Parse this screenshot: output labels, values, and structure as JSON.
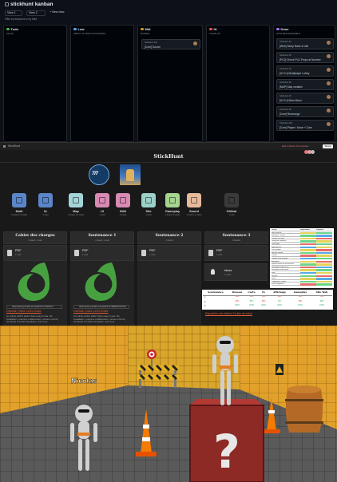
{
  "kanban": {
    "title": "stickhunt kanban",
    "tabs": [
      "View 1",
      "View 2",
      "+ New view"
    ],
    "filter_placeholder": "Filter by keyword or by field",
    "columns": [
      {
        "name": "Todo",
        "color": "#3fb950",
        "sub": "Self (0)"
      },
      {
        "name": "Low",
        "color": "#58a6ff",
        "sub": "ABOUT 15 TIDE US PLANNING"
      },
      {
        "name": "Mid",
        "color": "#d29922",
        "sub": "BUNDLE"
      },
      {
        "name": "Hi",
        "color": "#f85149",
        "sub": "CLEAN UP"
      },
      {
        "name": "Done",
        "color": "#a371f7",
        "sub": "WITH RECOGNIZABLE"
      }
    ],
    "mid_card": {
      "repo": "StickHunt #11",
      "title": "[Core] Sound"
    },
    "done_cards": [
      {
        "repo": "StickHunt #4",
        "title": "[Web] Setup Base of site"
      },
      {
        "repo": "StickHunt #5",
        "title": "[PLD] Check PLD Props at Number"
      },
      {
        "repo": "StickHunt #6",
        "title": "[UX IU] Multiplayer Lobby"
      },
      {
        "repo": "StickHunt #8",
        "title": "[MAP] Map creation"
      },
      {
        "repo": "StickHunt #3",
        "title": "[UX IU] Main Menu"
      },
      {
        "repo": "StickHunt #9",
        "title": "[Core] Rearrange"
      },
      {
        "repo": "StickHunt #10",
        "title": "[Core] Player / Move + Cam"
      }
    ]
  },
  "notion": {
    "tab_title": "StickHunt",
    "share_label": "Share",
    "banner_text": "Edit a Notion AI template",
    "page_title": "StickHunt",
    "tiles": [
      {
        "label": "Multi",
        "sub": "2 boards, 6 cards",
        "color": "#5a86c9"
      },
      {
        "label": "IA",
        "sub": "1 card",
        "color": "#5a86c9"
      },
      {
        "label": "Map",
        "sub": "1 board, 10 cards",
        "color": "#a4d4d7"
      },
      {
        "label": "UI",
        "sub": "1 card",
        "color": "#d78ab3"
      },
      {
        "label": "HUD",
        "sub": "6 cards",
        "color": "#d78ab3"
      },
      {
        "label": "Site",
        "sub": "1 card",
        "color": "#9bd0c8"
      },
      {
        "label": "Gameplay",
        "sub": "1 board, 6 cards",
        "color": "#a4d48d"
      },
      {
        "label": "Sound",
        "sub": "1 board, 2 cards",
        "color": "#e6b99b"
      },
      {
        "label": "GitHub",
        "sub": "1 card",
        "color": "#3a3a3a"
      }
    ],
    "sections": [
      {
        "title": "Cahier des charges",
        "sub": "1 board, 1 card"
      },
      {
        "title": "Soutenance 1",
        "sub": "1 board, 1 card"
      },
      {
        "title": "Soutenance 2",
        "sub": "1 board"
      },
      {
        "title": "Soutenance 3",
        "sub": "2 boards"
      }
    ],
    "pdf_label": "PDF",
    "pdf_count": "1 card",
    "gallery": [
      {
        "link": "https://www.youtube.com/watch?v=nKb0Vwn",
        "red": "Overleaf, Online LaTeX Editor",
        "desc": "An online LaTeX editor that's easy to use. No installation, real-time collaboration, version control, hundreds of LaTeX templates, and more."
      },
      {
        "link": "https://www.youtube.com/watch?v=WBC8xbwGTos",
        "red": "Overleaf, Online LaTeX Editor",
        "desc": "An online LaTeX editor that's easy to use. No installation, real-time collaboration, version control, hundreds of LaTeX templates, and more."
      }
    ],
    "ideas": {
      "label": "Ideas",
      "sub": "1 cards"
    },
    "task_table": {
      "headers": [
        "Tâches",
        "Responsable",
        "Suppléant"
      ],
      "rows": [
        [
          "Menu principal",
          "#e4d25a",
          "#6ad489"
        ],
        [
          "Multijoueur / Réseau",
          "#6ad489",
          "#5aa9e6"
        ],
        [
          "Chemins et ia cops",
          "#e4d25a",
          "#e86b6b"
        ],
        [
          "Timings de l'ambiance",
          "#6ad489",
          "#e4d25a"
        ],
        [
          "Rassembler",
          "#e86b6b",
          "#6ad489"
        ],
        [
          "Application fini",
          "#5aa9e6",
          "#e4d25a"
        ],
        [
          "Pas de temps",
          "#e4d25a",
          "#e86b6b"
        ],
        [
          "Mod Set Deleted",
          "#6ad489",
          "#5aa9e6"
        ],
        [
          "Caméra",
          "#e86b6b",
          "#e4d25a"
        ],
        [
          "Contrôle du personnage",
          "#5aa9e6",
          "#6ad489"
        ],
        [
          "Animations",
          "#e4d25a",
          "#e86b6b"
        ],
        [
          "Implémentation des mouvements",
          "#6ad489",
          "#e4d25a"
        ],
        [
          "Mécaniques d'ajout de fin",
          "#e86b6b",
          "#5aa9e6"
        ],
        [
          "Mécaniques d'ajout gardé",
          "#e4d25a",
          "#6ad489"
        ],
        [
          "Sons",
          "#5aa9e6",
          "#e4d25a"
        ],
        [
          "Site web",
          "#6ad489",
          "#e86b6b"
        ],
        [
          "Menus",
          "#e4d25a",
          "#5aa9e6"
        ],
        [
          "Progression / Récolte",
          "#6ad489",
          "#e4d25a"
        ],
        [
          "Bonus d'apparence",
          "#e86b6b",
          "#6ad489"
        ]
      ]
    },
    "progress_table": {
      "headers": [
        "Soutenance",
        "Réseau",
        "Carte",
        "IA",
        "Affichage",
        "Gameplay",
        "Site Web"
      ],
      "rows": [
        {
          "label": "1",
          "values": [
            "30%",
            "50%",
            "10%",
            "40%",
            "20%",
            "70%"
          ],
          "colors": [
            "#c0392b",
            "#c0392b",
            "#c0392b",
            "#c0392b",
            "#c0392b",
            "#c0392b"
          ]
        },
        {
          "label": "2",
          "values": [
            "60%",
            "80%",
            "50%",
            "70%",
            "60%",
            "80%"
          ],
          "colors": [
            "#c0392b",
            "#27ae60",
            "#c0392b",
            "#27ae60",
            "#c0392b",
            "#27ae60"
          ]
        },
        {
          "label": "3",
          "values": [
            "100%",
            "100%",
            "100%",
            "100%",
            "100%",
            "100%"
          ],
          "colors": [
            "#27ae60",
            "#27ae60",
            "#27ae60",
            "#27ae60",
            "#27ae60",
            "#27ae60"
          ]
        }
      ]
    },
    "table_link": "Répartition des tâches Feuille de calcul"
  },
  "game": {
    "player_name": "Nicolas"
  }
}
